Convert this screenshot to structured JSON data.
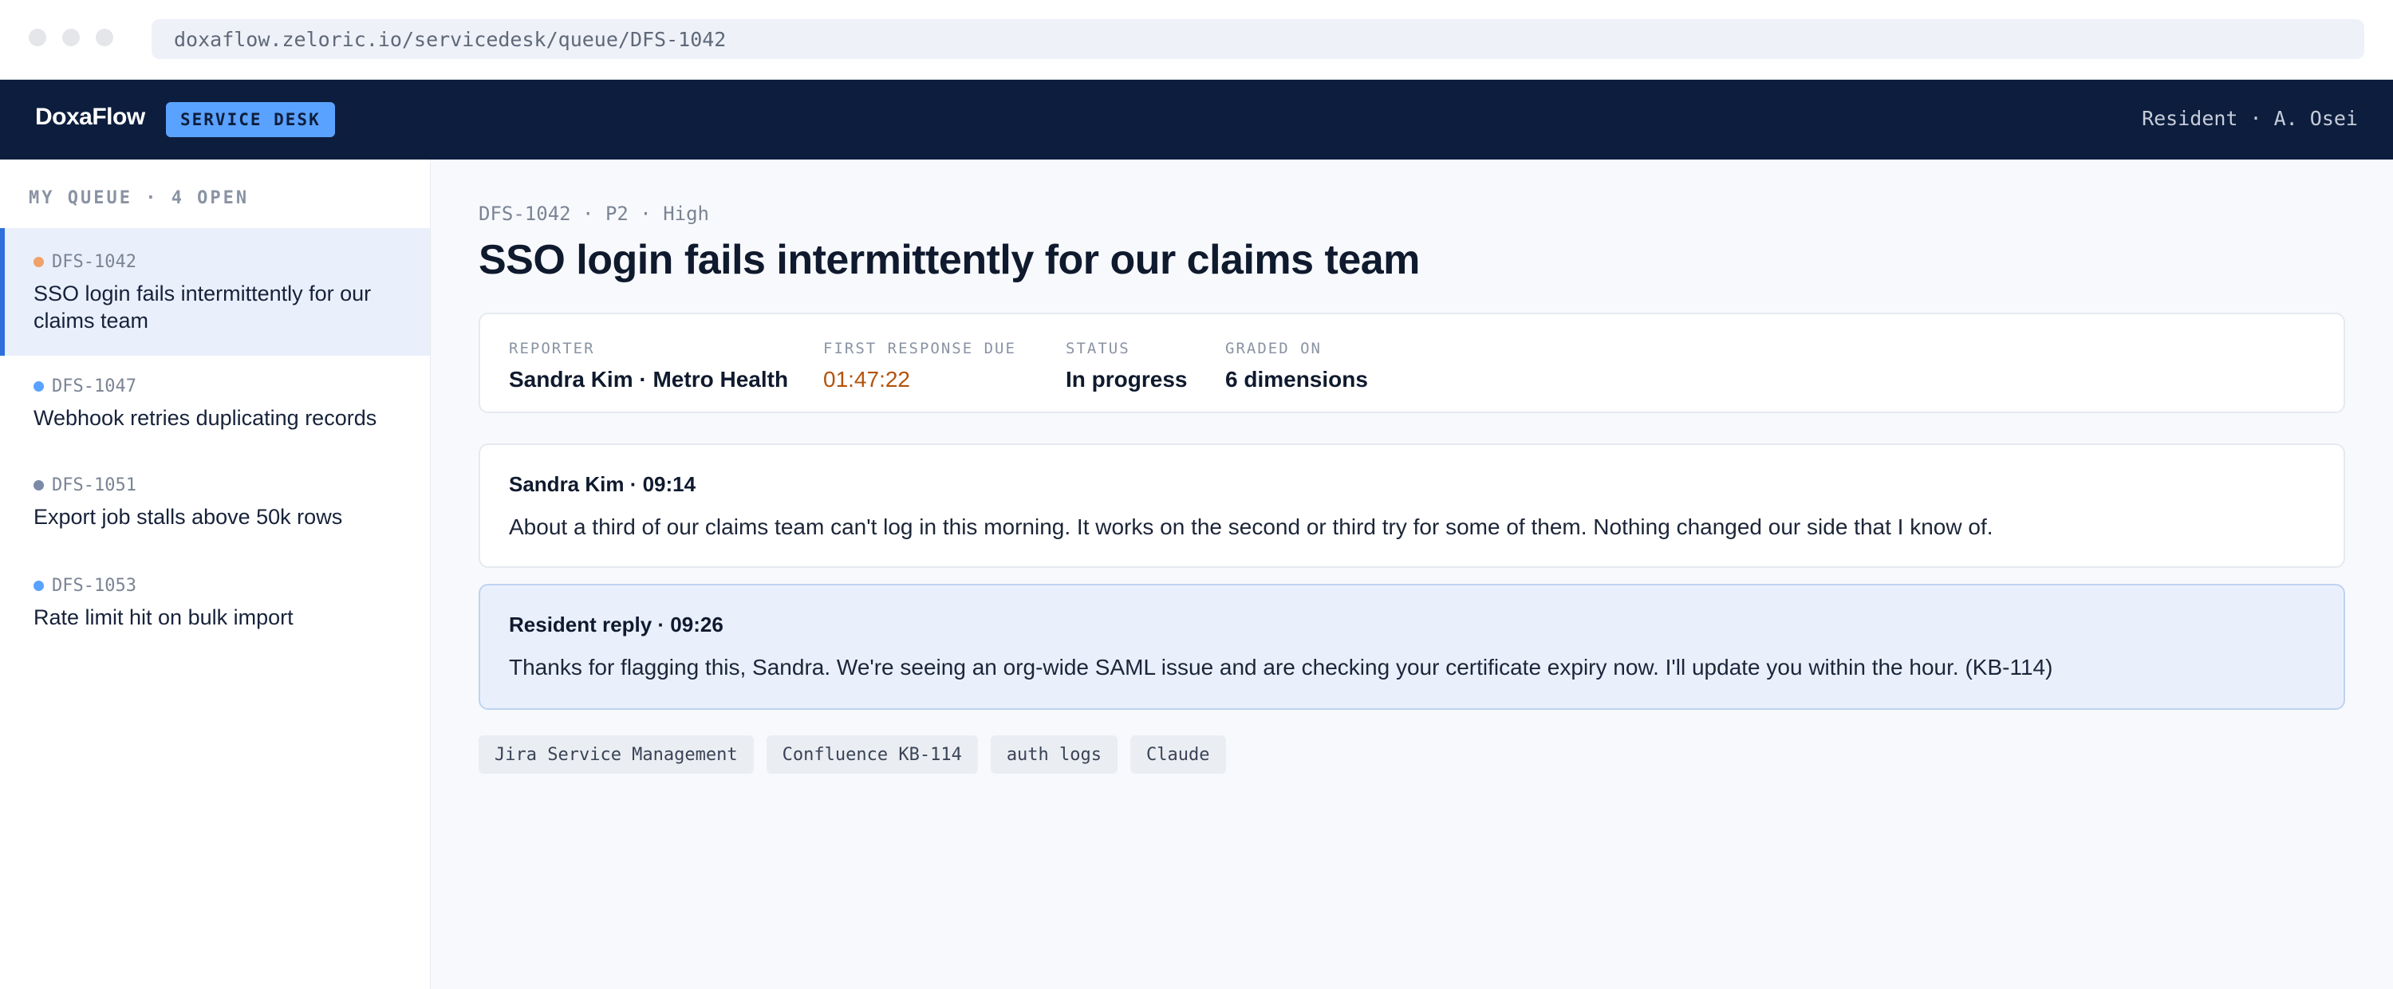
{
  "browser": {
    "url": "doxaflow.zeloric.io/servicedesk/queue/DFS-1042"
  },
  "header": {
    "brand": "DoxaFlow",
    "badge": "SERVICE DESK",
    "user": "Resident · A. Osei"
  },
  "sidebar": {
    "title": "MY QUEUE · 4 OPEN",
    "items": [
      {
        "id": "DFS-1042",
        "title": "SSO login fails intermittently for our claims team",
        "dot_color": "#f0a26a",
        "active": true
      },
      {
        "id": "DFS-1047",
        "title": "Webhook retries duplicating records",
        "dot_color": "#5aa2ff",
        "active": false
      },
      {
        "id": "DFS-1051",
        "title": "Export job stalls above 50k rows",
        "dot_color": "#7b8aa8",
        "active": false
      },
      {
        "id": "DFS-1053",
        "title": "Rate limit hit on bulk import",
        "dot_color": "#5aa2ff",
        "active": false
      }
    ]
  },
  "ticket": {
    "breadcrumb": "DFS-1042 · P2 · High",
    "title": "SSO login fails intermittently for our claims team",
    "meta": {
      "reporter_label": "REPORTER",
      "reporter_value": "Sandra Kim · Metro Health",
      "due_label": "FIRST RESPONSE DUE",
      "due_value": "01:47:22",
      "status_label": "STATUS",
      "status_value": "In progress",
      "graded_label": "GRADED ON",
      "graded_value": "6 dimensions"
    },
    "messages": [
      {
        "header": "Sandra Kim · 09:14",
        "body": "About a third of our claims team can't log in this morning. It works on the second or third try for some of them. Nothing changed our side that I know of."
      },
      {
        "header": "Resident reply · 09:26",
        "body": "Thanks for flagging this, Sandra. We're seeing an org-wide SAML issue and are checking your certificate expiry now. I'll update you within the hour. (KB-114)"
      }
    ],
    "tags": [
      "Jira Service Management",
      "Confluence KB-114",
      "auth logs",
      "Claude"
    ]
  },
  "colors": {
    "accent": "#2f6fdc",
    "header_bg": "#0d1d3d",
    "badge_bg": "#5aa2ff",
    "due_warning": "#b45309"
  }
}
